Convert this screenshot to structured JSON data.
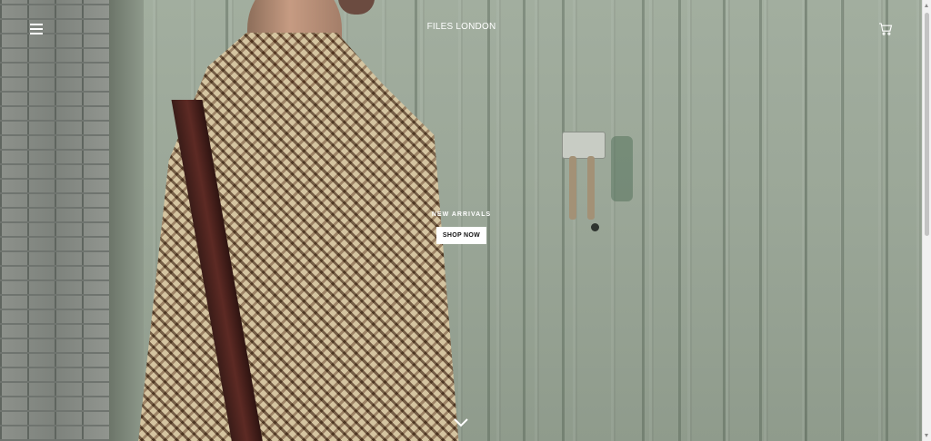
{
  "header": {
    "brand": "FILES LONDON",
    "menu_icon": "hamburger-menu-icon",
    "cart_icon": "shopping-cart-icon"
  },
  "hero": {
    "eyebrow": "NEW ARRIVALS",
    "cta_label": "SHOP NOW",
    "scroll_icon": "chevron-down-icon",
    "image_description_icon": "hero-photo"
  },
  "colors": {
    "text_on_image": "#ffffff",
    "button_bg": "#ffffff",
    "button_text": "#111111"
  }
}
